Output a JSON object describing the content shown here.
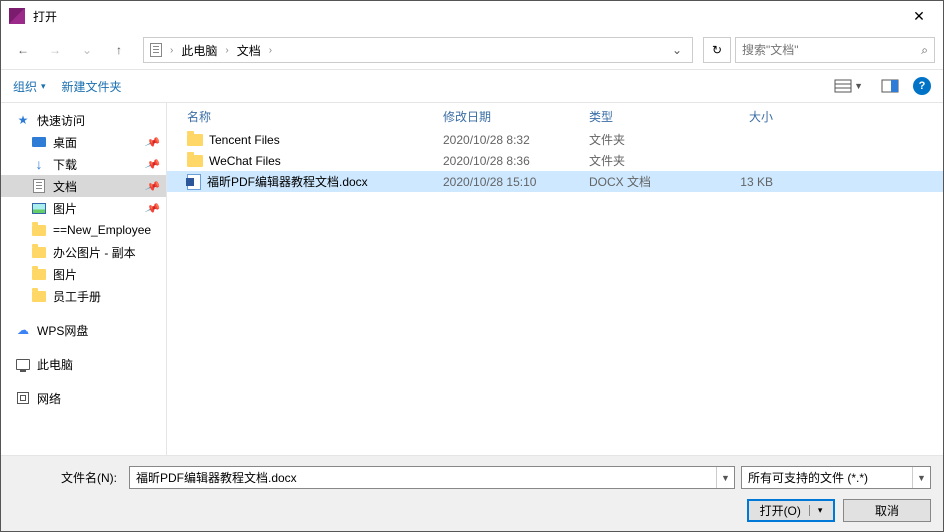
{
  "window": {
    "title": "打开",
    "close_glyph": "✕"
  },
  "nav": {
    "back_glyph": "←",
    "fwd_glyph": "→",
    "up_glyph": "↑",
    "crumbs": [
      "此电脑",
      "文档"
    ],
    "dropdown_glyph": "⌄",
    "refresh_glyph": "↻"
  },
  "search": {
    "placeholder": "搜索\"文档\"",
    "mag_glyph": "🔍"
  },
  "toolbar": {
    "organize": "组织",
    "organize_arrow": "▾",
    "newfolder": "新建文件夹",
    "help_glyph": "?"
  },
  "sidebar": [
    {
      "key": "quick",
      "label": "快速访问",
      "icon": "star",
      "child": false,
      "pin": false
    },
    {
      "key": "desktop",
      "label": "桌面",
      "icon": "desktop",
      "child": true,
      "pin": true
    },
    {
      "key": "downloads",
      "label": "下载",
      "icon": "down",
      "child": true,
      "pin": true
    },
    {
      "key": "documents",
      "label": "文档",
      "icon": "doc",
      "child": true,
      "pin": true,
      "selected": true
    },
    {
      "key": "pictures",
      "label": "图片",
      "icon": "pic",
      "child": true,
      "pin": true
    },
    {
      "key": "newemp",
      "label": "==New_Employee",
      "icon": "folder",
      "child": true,
      "pin": false
    },
    {
      "key": "office",
      "label": "办公图片 - 副本",
      "icon": "folder",
      "child": true,
      "pin": false
    },
    {
      "key": "pics2",
      "label": "图片",
      "icon": "folder",
      "child": true,
      "pin": false
    },
    {
      "key": "handbook",
      "label": "员工手册",
      "icon": "folder",
      "child": true,
      "pin": false
    },
    {
      "key": "spacer1",
      "label": "",
      "icon": "",
      "spacer": true
    },
    {
      "key": "wps",
      "label": "WPS网盘",
      "icon": "wps",
      "child": false,
      "pin": false
    },
    {
      "key": "spacer2",
      "label": "",
      "icon": "",
      "spacer": true
    },
    {
      "key": "thispc",
      "label": "此电脑",
      "icon": "pc",
      "child": false,
      "pin": false
    },
    {
      "key": "spacer3",
      "label": "",
      "icon": "",
      "spacer": true
    },
    {
      "key": "network",
      "label": "网络",
      "icon": "net",
      "child": false,
      "pin": false
    }
  ],
  "columns": {
    "name": "名称",
    "date": "修改日期",
    "type": "类型",
    "size": "大小"
  },
  "files": [
    {
      "name": "Tencent Files",
      "date": "2020/10/28 8:32",
      "type": "文件夹",
      "size": "",
      "icon": "folder",
      "selected": false
    },
    {
      "name": "WeChat Files",
      "date": "2020/10/28 8:36",
      "type": "文件夹",
      "size": "",
      "icon": "folder",
      "selected": false
    },
    {
      "name": "福昕PDF编辑器教程文档.docx",
      "date": "2020/10/28 15:10",
      "type": "DOCX 文档",
      "size": "13 KB",
      "icon": "docx",
      "selected": true
    }
  ],
  "footer": {
    "filename_label": "文件名(N):",
    "filename_value": "福昕PDF编辑器教程文档.docx",
    "filter_label": "所有可支持的文件 (*.*)",
    "open_btn": "打开(O)",
    "open_arrow": "▾",
    "cancel_btn": "取消"
  }
}
